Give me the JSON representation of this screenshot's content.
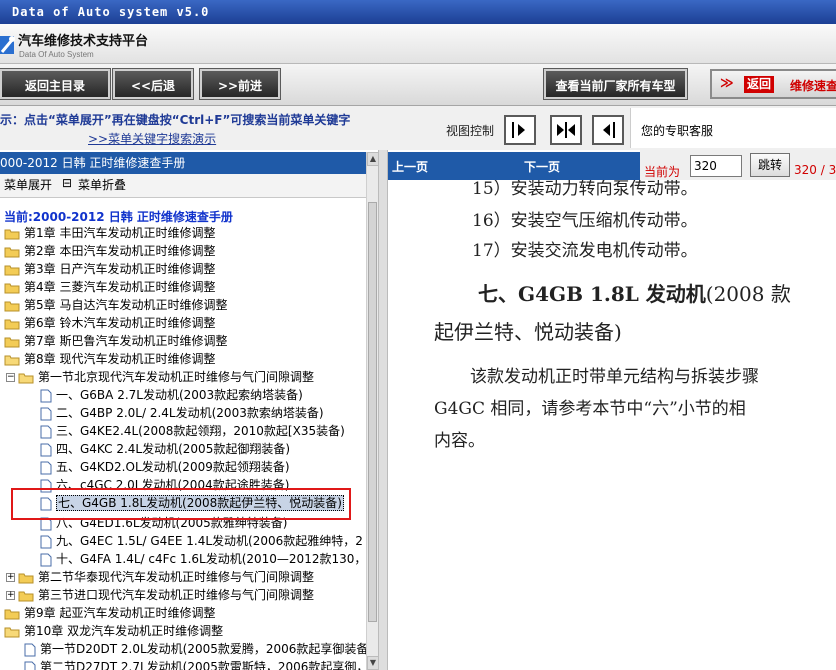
{
  "window": {
    "title": "Data of Auto system v5.0"
  },
  "brand": {
    "title": "汽车维修技术支持平台",
    "subtitle": "Data Of Auto System"
  },
  "toolbar": {
    "home": "返回主目录",
    "back": "<<后退",
    "forward": ">>前进",
    "models": "查看当前厂家所有车型",
    "return_arrow": "≫",
    "return_label": "返回",
    "return_target": "维修速查"
  },
  "hint": {
    "line1": "示：点击“菜单展开”再在键盘按“Ctrl+F”可搜索当前菜单关键字",
    "line2": ">>菜单关键字搜索演示",
    "view_control": "视图控制",
    "service": "您的专职客服"
  },
  "left": {
    "header": "000-2012 日韩 正时维修速查手册",
    "expand": "菜单展开",
    "collapse": "菜单折叠",
    "tree_title": "当前:2000-2012 日韩 正时维修速查手册",
    "nodes": [
      "第1章 丰田汽车发动机正时维修调整",
      "第2章 本田汽车发动机正时维修调整",
      "第3章 日产汽车发动机正时维修调整",
      "第4章 三菱汽车发动机正时维修调整",
      "第5章 马自达汽车发动机正时维修调整",
      "第6章 铃木汽车发动机正时维修调整",
      "第7章 斯巴鲁汽车发动机正时维修调整",
      "第8章 现代汽车发动机正时维修调整",
      "第一节北京现代汽车发动机正时维修与气门间隙调整",
      "一、G6BA 2.7L发动机(2003款起索纳塔装备)",
      "二、G4BP 2.0L/ 2.4L发动机(2003款索纳塔装备)",
      "三、G4KE2.4L(2008款起领翔，2010款起[X35装备)",
      "四、G4KC 2.4L发动机(2005款起御翔装备)",
      "五、G4KD2.OL发动机(2009款起领翔装备)",
      "六、c4GC 2.0L发动机(2004款起途胜装备)",
      "七、G4GB 1.8L发动机(2008款起伊兰特、悦动装备)",
      "八、G4ED1.6L发动机(2005款雅绅特装备)",
      "九、G4EC 1.5L/ G4EE 1.4L发动机(2006款起雅绅特，2",
      "十、G4FA 1.4L/ c4Fc 1.6L发动机(2010—2012款130，",
      "第二节华泰现代汽车发动机正时维修与气门间隙调整",
      "第三节进口现代汽车发动机正时维修与气门间隙调整",
      "第9章 起亚汽车发动机正时维修调整",
      "第10章 双龙汽车发动机正时维修调整",
      "第一节D20DT 2.0L发动机(2005款爱腾，2006款起享御装备",
      "第二节D27DT 2.7L发动机(2005款雷斯特，2006款起享御，"
    ]
  },
  "doc": {
    "prev": "上一页",
    "next": "下一页",
    "current_label": "当前为",
    "page_value": "320",
    "jump": "跳转",
    "pages": "320 / 3",
    "item15": "15）安装动力转向泵传动带。",
    "item16": "16）安装空气压缩机传动带。",
    "item17": "17）安装交流发电机传动带。",
    "heading_main": "七、G4GB 1.8L 发动机",
    "heading_tail": "(2008 款",
    "heading_line2": "起伊兰特、悦动装备)",
    "para1": "该款发动机正时带单元结构与拆装步骤",
    "para2": "G4GC 相同，请参考本节中“六”小节的相",
    "para3": "内容。"
  },
  "colors": {
    "header_blue": "#1f5aa8",
    "accent_red": "#d00000",
    "highlight": "#e01818"
  }
}
